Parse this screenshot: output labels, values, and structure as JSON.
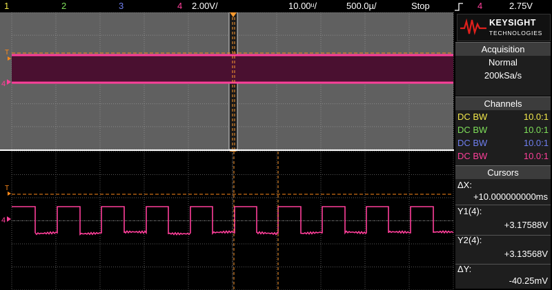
{
  "topbar": {
    "ch1": "1",
    "ch2": "2",
    "ch3": "3",
    "ch4": "4",
    "ch4_scale": "2.00V/",
    "time_scale": "10.00ᵘ/",
    "delay": "500.0µ/",
    "run_state": "Stop",
    "trigger_channel": "4",
    "trigger_level": "2.75V"
  },
  "colors": {
    "ch1": "#f2e84a",
    "ch2": "#7fe05a",
    "ch3": "#6f7ff0",
    "ch4": "#ff3f9a",
    "cursor": "#ff9a2e",
    "trigger": "#ff8a1a"
  },
  "markers": {
    "trigger_tag": "T",
    "ch4_tag": "4"
  },
  "brand": {
    "name": "KEYSIGHT",
    "sub": "TECHNOLOGIES"
  },
  "acquisition": {
    "title": "Acquisition",
    "mode": "Normal",
    "rate": "200kSa/s"
  },
  "channels": {
    "title": "Channels",
    "rows": [
      {
        "coupling": "DC BW",
        "probe": "10.0:1"
      },
      {
        "coupling": "DC BW",
        "probe": "10.0:1"
      },
      {
        "coupling": "DC BW",
        "probe": "10.0:1"
      },
      {
        "coupling": "DC BW",
        "probe": "10.0:1"
      }
    ]
  },
  "cursors": {
    "title": "Cursors",
    "dx_label": "ΔX:",
    "dx_value": "+10.000000000ms",
    "y1_label": "Y1(4):",
    "y1_value": "+3.17588V",
    "y2_label": "Y2(4):",
    "y2_value": "+3.13568V",
    "dy_label": "ΔY:",
    "dy_value": "-40.25mV"
  }
}
